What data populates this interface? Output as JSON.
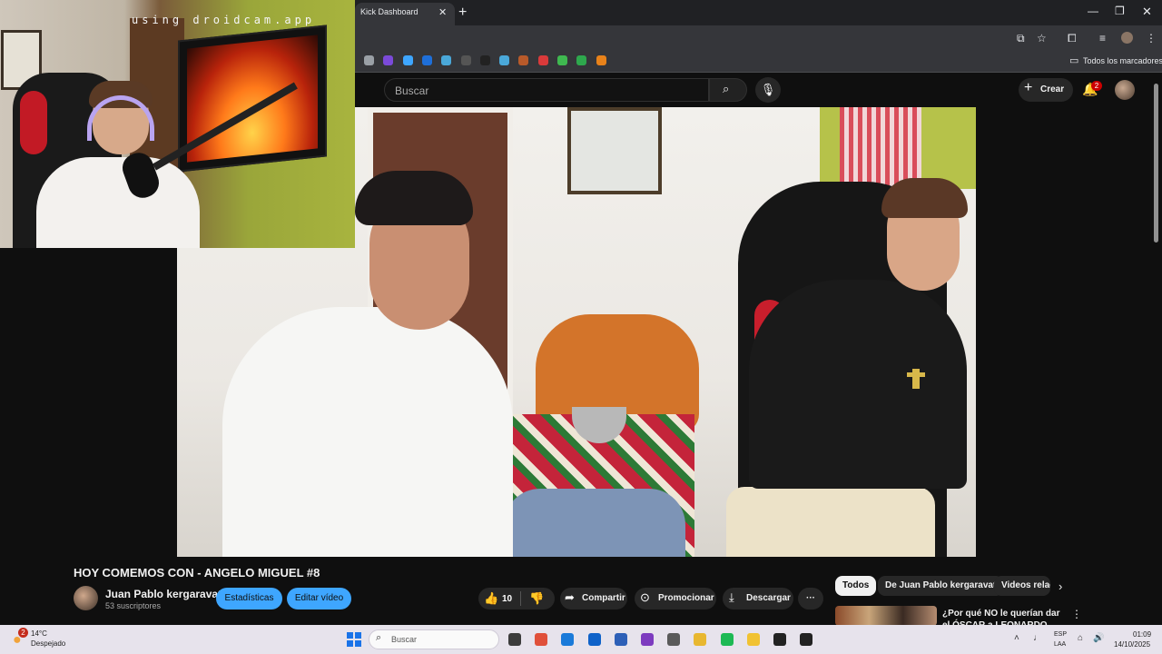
{
  "webcam": {
    "watermark": "using droidcam.app"
  },
  "browser": {
    "tab_title": "Kick Dashboard",
    "tab_close": "✕",
    "new_tab": "+",
    "window_controls": {
      "minimize": "—",
      "maximize": "❐",
      "close": "✕"
    },
    "toolbar_icons": [
      "cast-icon",
      "star-icon",
      "extensions-icon",
      "media-icon",
      "profile-icon",
      "menu-icon"
    ],
    "bookmark_colors": [
      "#9aa0a6",
      "#7b4ad9",
      "#3ea6ff",
      "#1e6fd9",
      "#4aa8d9",
      "#555555",
      "#222222",
      "#4aa8d9",
      "#b85a2a",
      "#d93a3a",
      "#3fb950",
      "#2ea84d",
      "#e8821a"
    ],
    "bookmarks_all_label": "Todos los marcadores"
  },
  "youtube": {
    "search_placeholder": "Buscar",
    "create_label": "Crear",
    "notification_count": "2"
  },
  "video": {
    "title": "HOY COMEMOS CON - ANGELO MIGUEL #8",
    "channel_name": "Juan Pablo kergaravat",
    "subscribers": "53 suscriptores",
    "stats_button": "Estadísticas",
    "edit_button": "Editar vídeo",
    "like_count": "10",
    "share_label": "Compartir",
    "promote_label": "Promocionar",
    "download_label": "Descargar",
    "more_label": "···"
  },
  "chips": {
    "all": "Todos",
    "channel": "De Juan Pablo kergaravat",
    "related": "Videos relac"
  },
  "recommended": {
    "title": "¿Por qué NO le querían dar el ÓSCAR a LEONARDO"
  },
  "taskbar": {
    "weather_temp": "14°C",
    "weather_desc": "Despejado",
    "weather_badge": "2",
    "search_placeholder": "Buscar",
    "app_colors": [
      "#3c3c3c",
      "#e0503a",
      "#1a7ad9",
      "#0f62c9",
      "#2d5fb7",
      "#7d3bbf",
      "#5a5a5a",
      "#e8b730",
      "#1db954",
      "#f1c232",
      "#222222",
      "#222222"
    ],
    "lang_line1": "ESP",
    "lang_line2": "LAA",
    "time": "01:09",
    "date": "14/10/2025"
  }
}
